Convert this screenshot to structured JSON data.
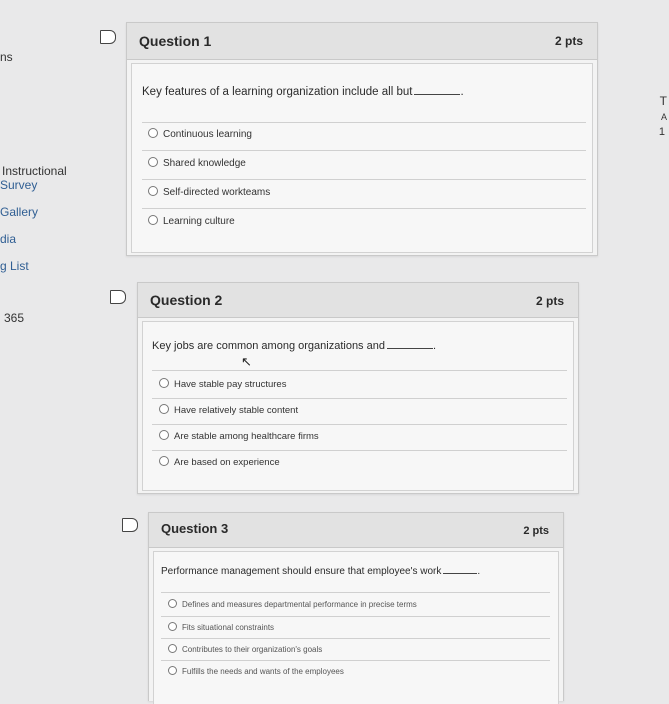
{
  "sidebar": {
    "items": [
      "ns",
      "Instructional",
      "Survey",
      "Gallery",
      "dia",
      "g List",
      "365"
    ]
  },
  "right_fragments": [
    "T",
    "A",
    "1"
  ],
  "questions": [
    {
      "title": "Question 1",
      "points": "2 pts",
      "text": "Key features of a learning organization include all but",
      "options": [
        "Continuous learning",
        "Shared knowledge",
        "Self-directed workteams",
        "Learning culture"
      ]
    },
    {
      "title": "Question 2",
      "points": "2 pts",
      "text": "Key jobs are common among organizations and",
      "options": [
        "Have stable pay structures",
        "Have relatively stable content",
        "Are stable among healthcare firms",
        "Are based on experience"
      ]
    },
    {
      "title": "Question 3",
      "points": "2 pts",
      "text": "Performance management should ensure that employee's work",
      "options": [
        "Defines and measures departmental performance in precise terms",
        "Fits situational constraints",
        "Contributes to their organization's goals",
        "Fulfills the needs and wants of the employees"
      ]
    }
  ]
}
